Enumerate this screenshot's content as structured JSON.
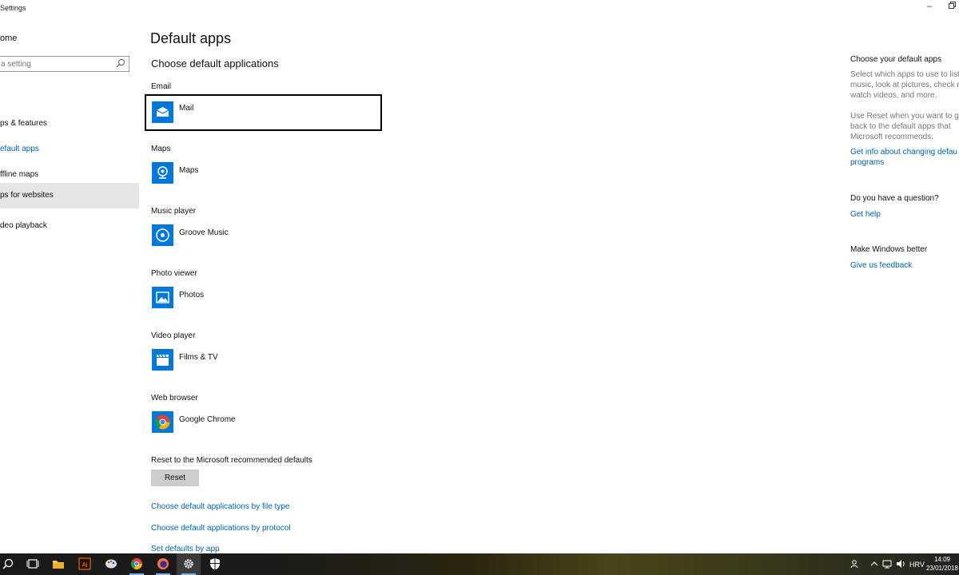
{
  "window": {
    "title": "Settings"
  },
  "nav": {
    "home_label": "ome",
    "search_placeholder": "a setting",
    "items": [
      {
        "label": "ps & features"
      },
      {
        "label": "efault apps"
      },
      {
        "label": "ffline maps"
      },
      {
        "label": "ps for websites"
      },
      {
        "label": "deo playback"
      }
    ]
  },
  "main": {
    "title": "Default apps",
    "subheader": "Choose default applications",
    "categories": [
      {
        "label": "Email",
        "app": "Mail",
        "icon": "mail-icon"
      },
      {
        "label": "Maps",
        "app": "Maps",
        "icon": "maps-icon"
      },
      {
        "label": "Music player",
        "app": "Groove Music",
        "icon": "groove-music-icon"
      },
      {
        "label": "Photo viewer",
        "app": "Photos",
        "icon": "photos-icon"
      },
      {
        "label": "Video player",
        "app": "Films & TV",
        "icon": "films-tv-icon"
      },
      {
        "label": "Web browser",
        "app": "Google Chrome",
        "icon": "chrome-icon"
      }
    ],
    "reset_label": "Reset to the Microsoft recommended defaults",
    "reset_button": "Reset",
    "links": [
      "Choose default applications by file type",
      "Choose default applications by protocol",
      "Set defaults by app"
    ]
  },
  "right": {
    "heading": "Choose your default apps",
    "text1": "Select which apps to use to list\nmusic, look at pictures, check m\nwatch videos, and more.",
    "text2": "Use Reset when you want to go\nback to the default apps that\nMicrosoft recommends.",
    "link1": "Get info about changing defau\nprograms",
    "question_heading": "Do you have a question?",
    "help_link": "Get help",
    "better_heading": "Make Windows better",
    "feedback_link": "Give us feedback"
  },
  "taskbar": {
    "language": "HRV",
    "time": "14:09",
    "date": "23/01/2018",
    "icons": [
      "search-icon",
      "task-view-icon",
      "file-explorer-icon",
      "adobe-illustrator-icon",
      "paint-icon",
      "chrome-icon",
      "firefox-icon",
      "settings-icon",
      "windows-defender-icon"
    ]
  },
  "colors": {
    "accent": "#0063b1",
    "icon_blue": "#0078d7",
    "reset_bg": "#cccccc"
  }
}
